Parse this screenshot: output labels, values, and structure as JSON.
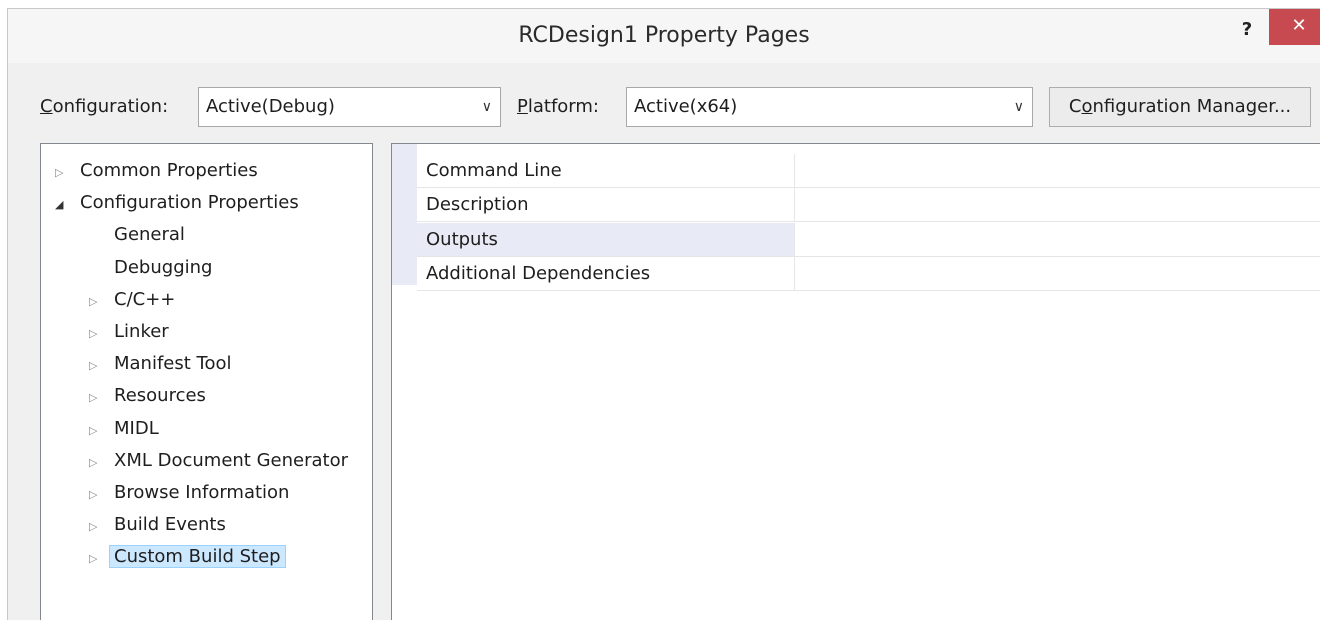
{
  "window": {
    "title": "RCDesign1 Property Pages",
    "help_label": "?",
    "close_label": "✕"
  },
  "config_bar": {
    "configuration_label_prefix": "C",
    "configuration_label_rest": "onfiguration:",
    "configuration_value": "Active(Debug)",
    "platform_label_prefix": "P",
    "platform_label_rest": "latform:",
    "platform_value": "Active(x64)",
    "config_manager_prefix": "C",
    "config_manager_mnemonic": "o",
    "config_manager_rest": "nfiguration Manager..."
  },
  "tree": {
    "items": [
      {
        "label": "Common Properties",
        "expander": "collapsed"
      },
      {
        "label": "Configuration Properties",
        "expander": "expanded"
      },
      {
        "label": "General",
        "expander": "none"
      },
      {
        "label": "Debugging",
        "expander": "none"
      },
      {
        "label": "C/C++",
        "expander": "collapsed"
      },
      {
        "label": "Linker",
        "expander": "collapsed"
      },
      {
        "label": "Manifest Tool",
        "expander": "collapsed"
      },
      {
        "label": "Resources",
        "expander": "collapsed"
      },
      {
        "label": "MIDL",
        "expander": "collapsed"
      },
      {
        "label": "XML Document Generator",
        "expander": "collapsed"
      },
      {
        "label": "Browse Information",
        "expander": "collapsed"
      },
      {
        "label": "Build Events",
        "expander": "collapsed"
      },
      {
        "label": "Custom Build Step",
        "expander": "collapsed",
        "selected": true
      }
    ]
  },
  "grid": {
    "rows": [
      {
        "name": "Command Line",
        "value": ""
      },
      {
        "name": "Description",
        "value": ""
      },
      {
        "name": "Outputs",
        "value": "",
        "selected": true
      },
      {
        "name": "Additional Dependencies",
        "value": ""
      }
    ]
  }
}
